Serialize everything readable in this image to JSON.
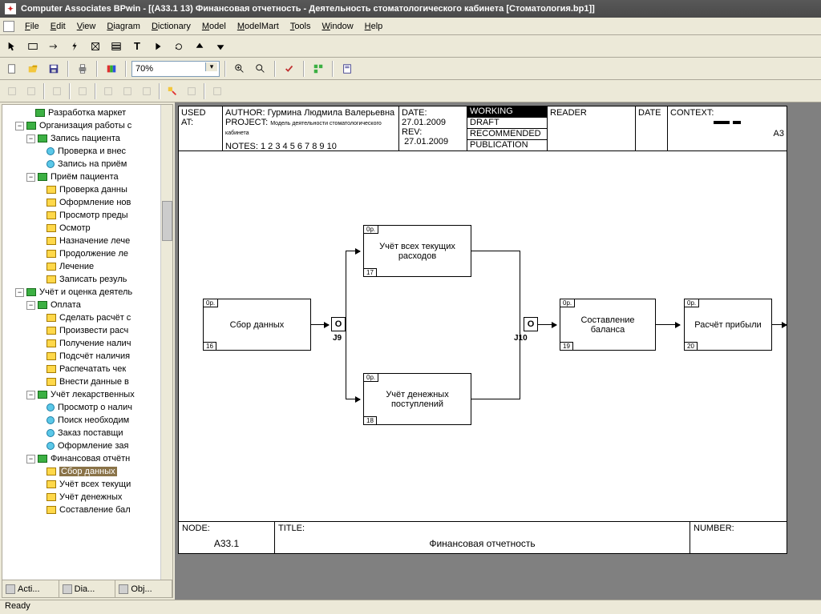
{
  "title": "Computer Associates BPwin - [(А33.1 13) Финансовая отчетность - Деятельность стоматологического кабинета [Стоматология.bp1]]",
  "menu": [
    "File",
    "Edit",
    "View",
    "Diagram",
    "Dictionary",
    "Model",
    "ModelMart",
    "Tools",
    "Window",
    "Help"
  ],
  "zoom": "70%",
  "tree": [
    {
      "d": 2,
      "i": "act",
      "e": "",
      "t": "Разработка маркет"
    },
    {
      "d": 1,
      "i": "act",
      "e": "-",
      "t": "Организация работы с"
    },
    {
      "d": 2,
      "i": "act",
      "e": "-",
      "t": "Запись пациента"
    },
    {
      "d": 3,
      "i": "circ",
      "e": "",
      "t": "Проверка и внес"
    },
    {
      "d": 3,
      "i": "circ",
      "e": "",
      "t": "Запись на приём"
    },
    {
      "d": 2,
      "i": "act",
      "e": "-",
      "t": "Приём пациента"
    },
    {
      "d": 3,
      "i": "sub",
      "e": "",
      "t": "Проверка данны"
    },
    {
      "d": 3,
      "i": "sub",
      "e": "",
      "t": "Оформление нов"
    },
    {
      "d": 3,
      "i": "sub",
      "e": "",
      "t": "Просмотр преды"
    },
    {
      "d": 3,
      "i": "sub",
      "e": "",
      "t": "Осмотр"
    },
    {
      "d": 3,
      "i": "sub",
      "e": "",
      "t": "Назначение лече"
    },
    {
      "d": 3,
      "i": "sub",
      "e": "",
      "t": "Продолжение ле"
    },
    {
      "d": 3,
      "i": "sub",
      "e": "",
      "t": "Лечение"
    },
    {
      "d": 3,
      "i": "sub",
      "e": "",
      "t": "Записать резуль"
    },
    {
      "d": 1,
      "i": "act",
      "e": "-",
      "t": "Учёт и оценка деятель"
    },
    {
      "d": 2,
      "i": "act",
      "e": "-",
      "t": "Оплата"
    },
    {
      "d": 3,
      "i": "sub",
      "e": "",
      "t": "Сделать расчёт с"
    },
    {
      "d": 3,
      "i": "sub",
      "e": "",
      "t": "Произвести расч"
    },
    {
      "d": 3,
      "i": "sub",
      "e": "",
      "t": "Получение налич"
    },
    {
      "d": 3,
      "i": "sub",
      "e": "",
      "t": "Подсчёт наличия"
    },
    {
      "d": 3,
      "i": "sub",
      "e": "",
      "t": "Распечатать чек"
    },
    {
      "d": 3,
      "i": "sub",
      "e": "",
      "t": "Внести данные в"
    },
    {
      "d": 2,
      "i": "act",
      "e": "-",
      "t": "Учёт лекарственных"
    },
    {
      "d": 3,
      "i": "circ",
      "e": "",
      "t": "Просмотр о налич"
    },
    {
      "d": 3,
      "i": "circ",
      "e": "",
      "t": "Поиск необходим"
    },
    {
      "d": 3,
      "i": "circ",
      "e": "",
      "t": "Заказ поставщи"
    },
    {
      "d": 3,
      "i": "circ",
      "e": "",
      "t": "Оформление зая"
    },
    {
      "d": 2,
      "i": "act",
      "e": "-",
      "t": "Финансовая отчётн"
    },
    {
      "d": 3,
      "i": "sub",
      "e": "",
      "t": "Сбор данных",
      "sel": true
    },
    {
      "d": 3,
      "i": "sub",
      "e": "",
      "t": "Учёт всех текущи"
    },
    {
      "d": 3,
      "i": "sub",
      "e": "",
      "t": "Учёт денежных"
    },
    {
      "d": 3,
      "i": "sub",
      "e": "",
      "t": "Составление бал"
    }
  ],
  "sb_tabs": [
    "Acti...",
    "Dia...",
    "Obj..."
  ],
  "header": {
    "used_at": "USED AT:",
    "author_lbl": "AUTHOR:",
    "author": "Гурмина Людмила Валерьевна",
    "project_lbl": "PROJECT:",
    "project": "Модель деятельности стоматологического кабинета",
    "date_lbl": "DATE:",
    "date": "27.01.2009",
    "rev_lbl": "REV:",
    "rev": "27.01.2009",
    "notes": "NOTES: 1 2 3 4 5 6 7 8 9 10",
    "status": [
      "WORKING",
      "DRAFT",
      "RECOMMENDED",
      "PUBLICATION"
    ],
    "reader": "READER",
    "hdate": "DATE",
    "context": "CONTEXT:",
    "a3": "А3"
  },
  "boxes": {
    "b1": {
      "tl": "0р.",
      "bl": "16",
      "txt": "Сбор данных"
    },
    "b2": {
      "tl": "0р.",
      "bl": "17",
      "txt": "Учёт всех текущих расходов"
    },
    "b3": {
      "tl": "0р.",
      "bl": "18",
      "txt": "Учёт денежных поступлений"
    },
    "b4": {
      "tl": "0р.",
      "bl": "19",
      "txt": "Составление баланса"
    },
    "b5": {
      "tl": "0р.",
      "bl": "20",
      "txt": "Расчёт прибыли"
    }
  },
  "junctions": {
    "j9": "J9",
    "j10": "J10",
    "letter": "O"
  },
  "footer": {
    "node_lbl": "NODE:",
    "node": "А33.1",
    "title_lbl": "TITLE:",
    "title": "Финансовая отчетность",
    "number_lbl": "NUMBER:"
  },
  "status": "Ready"
}
